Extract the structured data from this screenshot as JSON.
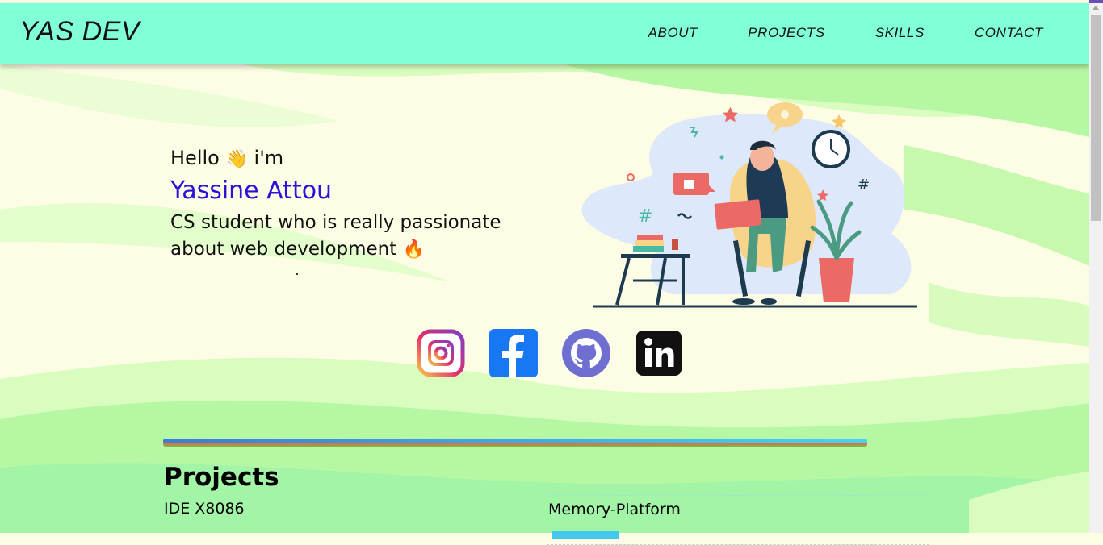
{
  "colors": {
    "navbar_bg": "#80ffd8",
    "name_color": "#2a12d8",
    "wave_green": "#a8f59a",
    "wave_cream": "#fdfde6"
  },
  "navbar": {
    "brand": "YAS DEV",
    "links": [
      "ABOUT",
      "PROJECTS",
      "SKILLS",
      "CONTACT"
    ]
  },
  "hero": {
    "greeting": "Hello",
    "greeting_emoji": "👋",
    "greeting_suffix": "i'm",
    "name": "Yassine Attou",
    "tagline": "CS student who is really passionate about web development",
    "tagline_emoji": "🔥",
    "illustration": "person-with-laptop-illustration"
  },
  "socials": [
    {
      "name": "instagram",
      "icon": "instagram-icon"
    },
    {
      "name": "facebook",
      "icon": "facebook-icon"
    },
    {
      "name": "github",
      "icon": "github-icon"
    },
    {
      "name": "linkedin",
      "icon": "linkedin-icon"
    }
  ],
  "projects": {
    "title": "Projects",
    "items": [
      {
        "name": "IDE X8086"
      },
      {
        "name": "Memory-Platform"
      }
    ]
  }
}
